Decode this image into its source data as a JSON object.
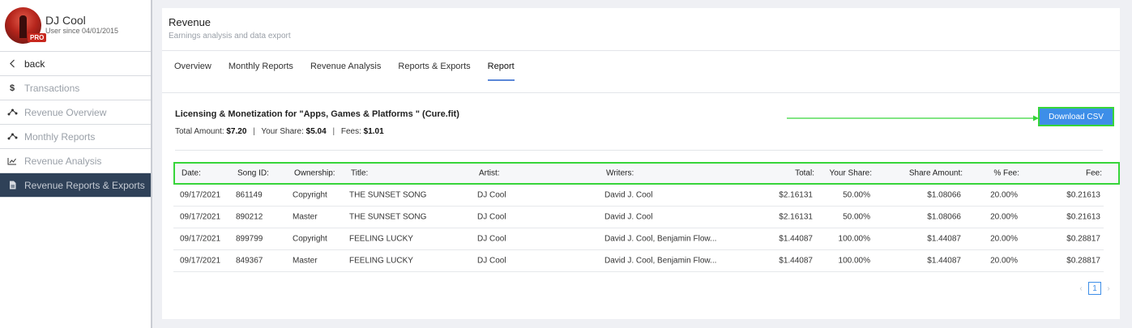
{
  "user": {
    "name": "DJ Cool",
    "since": "User since 04/01/2015",
    "badge": "PRO"
  },
  "sidebar": {
    "back_label": "back",
    "items": [
      {
        "label": "Transactions",
        "icon": "dollar-icon"
      },
      {
        "label": "Revenue Overview",
        "icon": "nodes-icon"
      },
      {
        "label": "Monthly Reports",
        "icon": "nodes-icon"
      },
      {
        "label": "Revenue Analysis",
        "icon": "line-chart-icon"
      },
      {
        "label": "Revenue Reports & Exports",
        "icon": "document-icon",
        "active": true
      }
    ]
  },
  "header": {
    "title": "Revenue",
    "subtitle": "Earnings analysis and data export"
  },
  "tabs": [
    {
      "label": "Overview"
    },
    {
      "label": "Monthly Reports"
    },
    {
      "label": "Revenue Analysis"
    },
    {
      "label": "Reports & Exports"
    },
    {
      "label": "Report",
      "active": true
    }
  ],
  "report": {
    "title": "Licensing & Monetization for \"Apps, Games & Platforms \" (Cure.fit)",
    "total_label": "Total Amount:",
    "total_value": "$7.20",
    "share_label": "Your Share:",
    "share_value": "$5.04",
    "fees_label": "Fees:",
    "fees_value": "$1.01",
    "separator": "|",
    "download_label": "Download CSV"
  },
  "table": {
    "headers": {
      "date": "Date:",
      "song": "Song ID:",
      "own": "Ownership:",
      "title": "Title:",
      "artist": "Artist:",
      "writers": "Writers:",
      "total": "Total:",
      "share": "Your Share:",
      "amount": "Share Amount:",
      "pct": "% Fee:",
      "fee": "Fee:"
    },
    "rows": [
      {
        "date": "09/17/2021",
        "song": "861149",
        "own": "Copyright",
        "title": "THE SUNSET SONG",
        "artist": "DJ Cool",
        "writers": "David J. Cool",
        "total": "$2.16131",
        "share": "50.00%",
        "amount": "$1.08066",
        "pct": "20.00%",
        "fee": "$0.21613"
      },
      {
        "date": "09/17/2021",
        "song": "890212",
        "own": "Master",
        "title": "THE SUNSET SONG",
        "artist": "DJ Cool",
        "writers": "David J. Cool",
        "total": "$2.16131",
        "share": "50.00%",
        "amount": "$1.08066",
        "pct": "20.00%",
        "fee": "$0.21613"
      },
      {
        "date": "09/17/2021",
        "song": "899799",
        "own": "Copyright",
        "title": "FEELING LUCKY",
        "artist": "DJ Cool",
        "writers": "David J. Cool, Benjamin Flow...",
        "total": "$1.44087",
        "share": "100.00%",
        "amount": "$1.44087",
        "pct": "20.00%",
        "fee": "$0.28817"
      },
      {
        "date": "09/17/2021",
        "song": "849367",
        "own": "Master",
        "title": "FEELING LUCKY",
        "artist": "DJ Cool",
        "writers": "David J. Cool, Benjamin Flow...",
        "total": "$1.44087",
        "share": "100.00%",
        "amount": "$1.44087",
        "pct": "20.00%",
        "fee": "$0.28817"
      }
    ]
  },
  "pagination": {
    "current": "1",
    "prev": "‹",
    "next": "›"
  },
  "colors": {
    "accent": "#3d8ee8",
    "highlight": "#37d53a",
    "sidebar_active": "#2f4158"
  }
}
